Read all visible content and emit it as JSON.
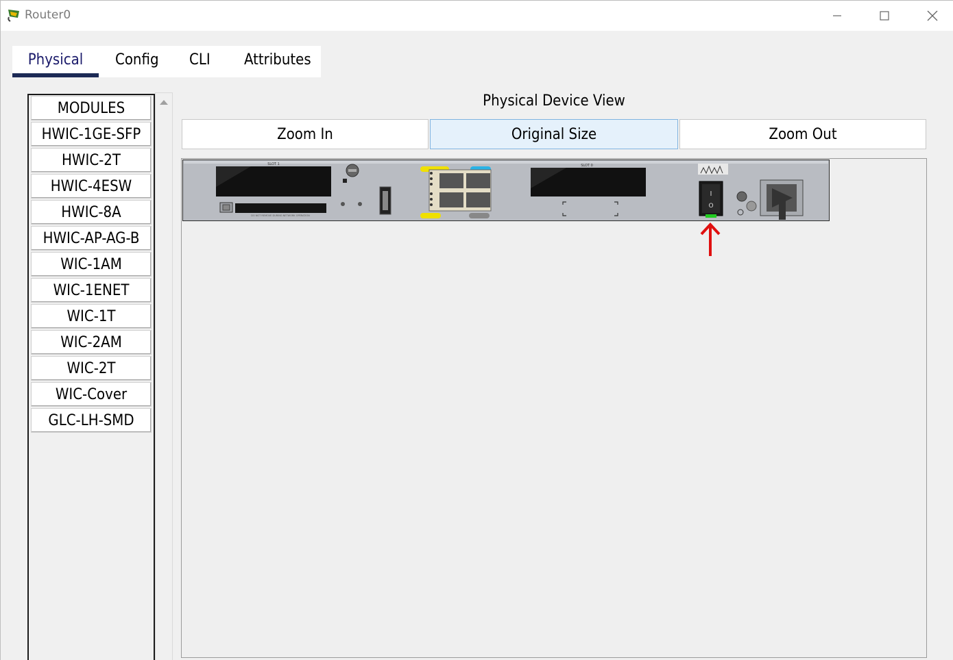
{
  "window": {
    "title": "Router0",
    "minimize": "—",
    "maximize": "☐",
    "close": "✕"
  },
  "tabs": [
    "Physical",
    "Config",
    "CLI",
    "Attributes"
  ],
  "modules": {
    "header": "MODULES",
    "items": [
      "HWIC-1GE-SFP",
      "HWIC-2T",
      "HWIC-4ESW",
      "HWIC-8A",
      "HWIC-AP-AG-B",
      "WIC-1AM",
      "WIC-1ENET",
      "WIC-1T",
      "WIC-2AM",
      "WIC-2T",
      "WIC-Cover",
      "GLC-LH-SMD"
    ]
  },
  "view": {
    "title": "Physical Device View",
    "zoom_in": "Zoom In",
    "original_size": "Original Size",
    "zoom_out": "Zoom Out"
  },
  "device": {
    "slot1_label": "SLOT 1",
    "slot0_label": "SLOT 0",
    "power_symbol_on": "I",
    "power_symbol_off": "O",
    "power_led_color": "#22cc22",
    "arrow_color": "#e01010"
  }
}
